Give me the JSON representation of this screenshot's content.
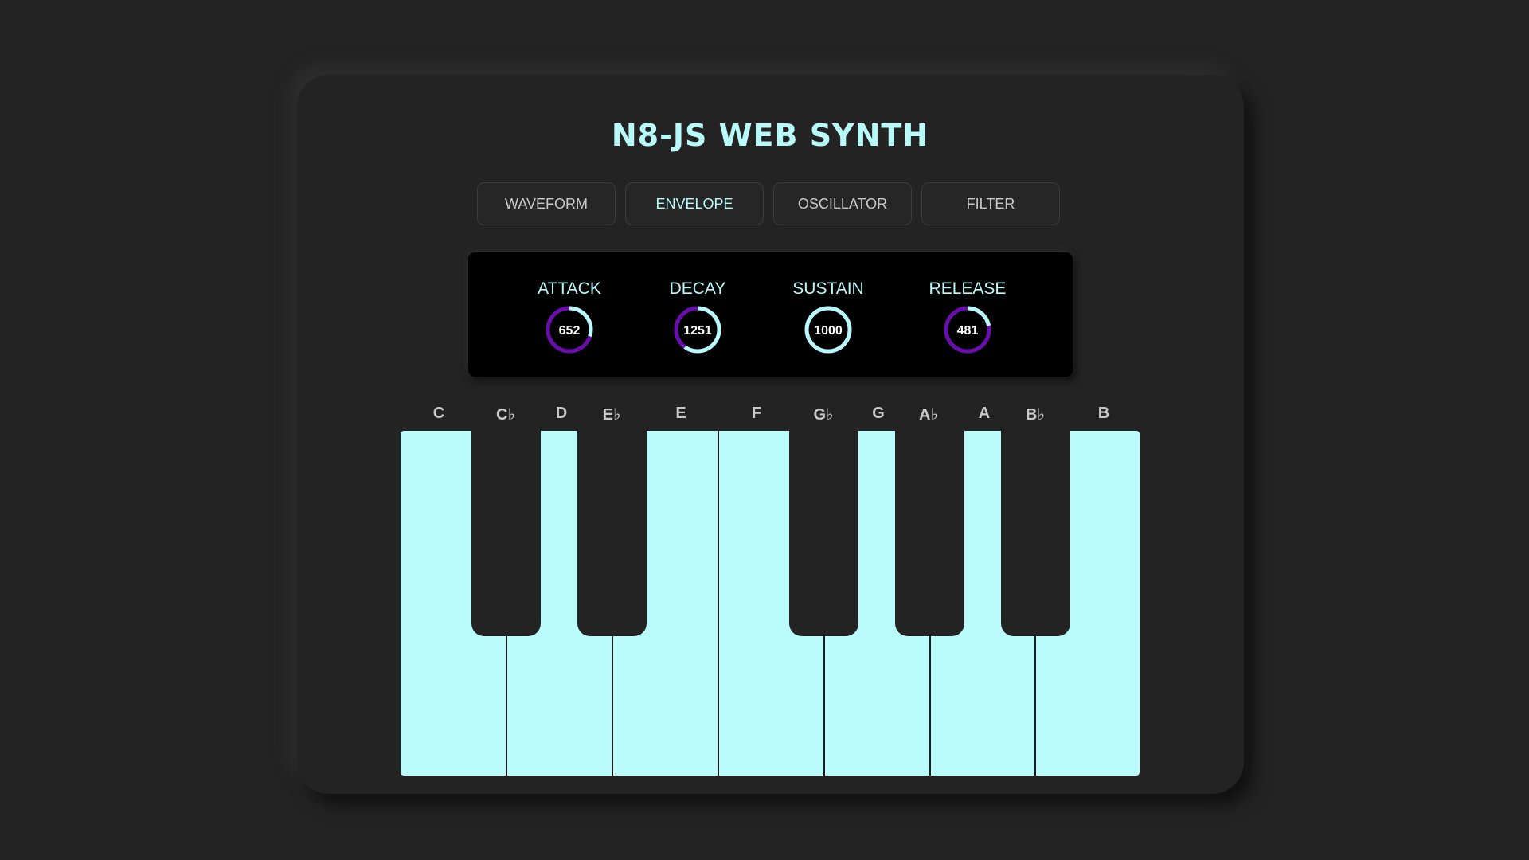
{
  "app": {
    "title": "N8-JS WEB SYNTH"
  },
  "tabs": [
    {
      "label": "WAVEFORM",
      "active": false
    },
    {
      "label": "ENVELOPE",
      "active": true
    },
    {
      "label": "OSCILLATOR",
      "active": false
    },
    {
      "label": "FILTER",
      "active": false
    }
  ],
  "envelope": {
    "knobs": [
      {
        "label": "ATTACK",
        "value": "652",
        "fill_fraction": 0.3
      },
      {
        "label": "DECAY",
        "value": "1251",
        "fill_fraction": 0.6
      },
      {
        "label": "SUSTAIN",
        "value": "1000",
        "fill_fraction": 1.0
      },
      {
        "label": "RELEASE",
        "value": "481",
        "fill_fraction": 0.22
      }
    ]
  },
  "keyboard": {
    "note_labels": [
      "C",
      "C♭",
      "D",
      "E♭",
      "E",
      "F",
      "G♭",
      "G",
      "A♭",
      "A",
      "B♭",
      "B"
    ]
  },
  "colors": {
    "accent": "#b8f9f9",
    "knob_track": "#6a0dad",
    "white_key": "#bafbfb",
    "black_key": "#232323",
    "background": "#232323"
  }
}
